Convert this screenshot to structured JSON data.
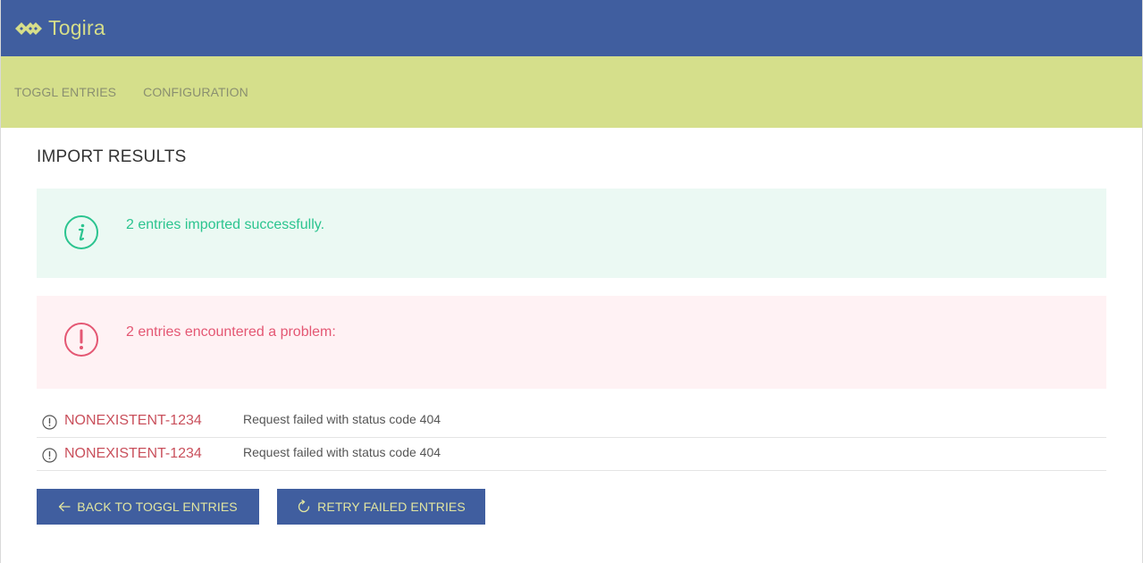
{
  "app": {
    "title": "Togira",
    "logo_icon": "togira-logo-icon"
  },
  "nav": {
    "items": [
      {
        "label": "TOGGL ENTRIES"
      },
      {
        "label": "CONFIGURATION"
      }
    ]
  },
  "page": {
    "title": "IMPORT RESULTS"
  },
  "alerts": {
    "success": {
      "icon": "info-circle-icon",
      "text": "2 entries imported successfully.",
      "color": "#2bc48f",
      "background": "#ebf9f3"
    },
    "error": {
      "icon": "exclamation-circle-icon",
      "text": "2 entries encountered a problem:",
      "color": "#e45773",
      "background": "#fff2f4"
    }
  },
  "failures": [
    {
      "key": "NONEXISTENT-1234",
      "message": "Request failed with status code 404"
    },
    {
      "key": "NONEXISTENT-1234",
      "message": "Request failed with status code 404"
    }
  ],
  "actions": {
    "back_label": "BACK TO TOGGL ENTRIES",
    "back_icon": "arrow-left-icon",
    "retry_label": "RETRY FAILED ENTRIES",
    "retry_icon": "refresh-icon"
  },
  "colors": {
    "primary": "#405e9f",
    "accent": "#d5df8b"
  }
}
